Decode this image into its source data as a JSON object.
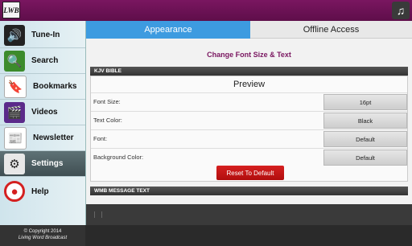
{
  "header": {
    "logo_text": "LWB",
    "music_icon": "music-note-icon"
  },
  "sidebar": {
    "items": [
      {
        "label": "Tune-In",
        "icon": "speaker-icon"
      },
      {
        "label": "Search",
        "icon": "search-icon"
      },
      {
        "label": "Bookmarks",
        "icon": "bookmark-icon"
      },
      {
        "label": "Videos",
        "icon": "film-icon"
      },
      {
        "label": "Newsletter",
        "icon": "newsletter-icon"
      },
      {
        "label": "Settings",
        "icon": "gears-icon"
      },
      {
        "label": "Help",
        "icon": "lifebuoy-icon"
      }
    ],
    "active": "Settings",
    "copyright_line1": "© Copyright 2014",
    "copyright_line2": "Living Word Broadcast"
  },
  "tabs": [
    {
      "label": "Appearance",
      "active": true
    },
    {
      "label": "Offline Access",
      "active": false
    }
  ],
  "main": {
    "heading": "Change Font Size & Text",
    "section1": "KJV BIBLE",
    "preview_label": "Preview",
    "rows": [
      {
        "label": "Font Size:",
        "value": "16pt"
      },
      {
        "label": "Text Color:",
        "value": "Black"
      },
      {
        "label": "Font:",
        "value": "Default"
      },
      {
        "label": "Background Color:",
        "value": "Default"
      }
    ],
    "reset_label": "Reset To Default",
    "section2": "WMB MESSAGE TEXT"
  },
  "colors": {
    "brand": "#7a1660",
    "tab_active": "#3d9be0",
    "reset": "#c41515"
  }
}
